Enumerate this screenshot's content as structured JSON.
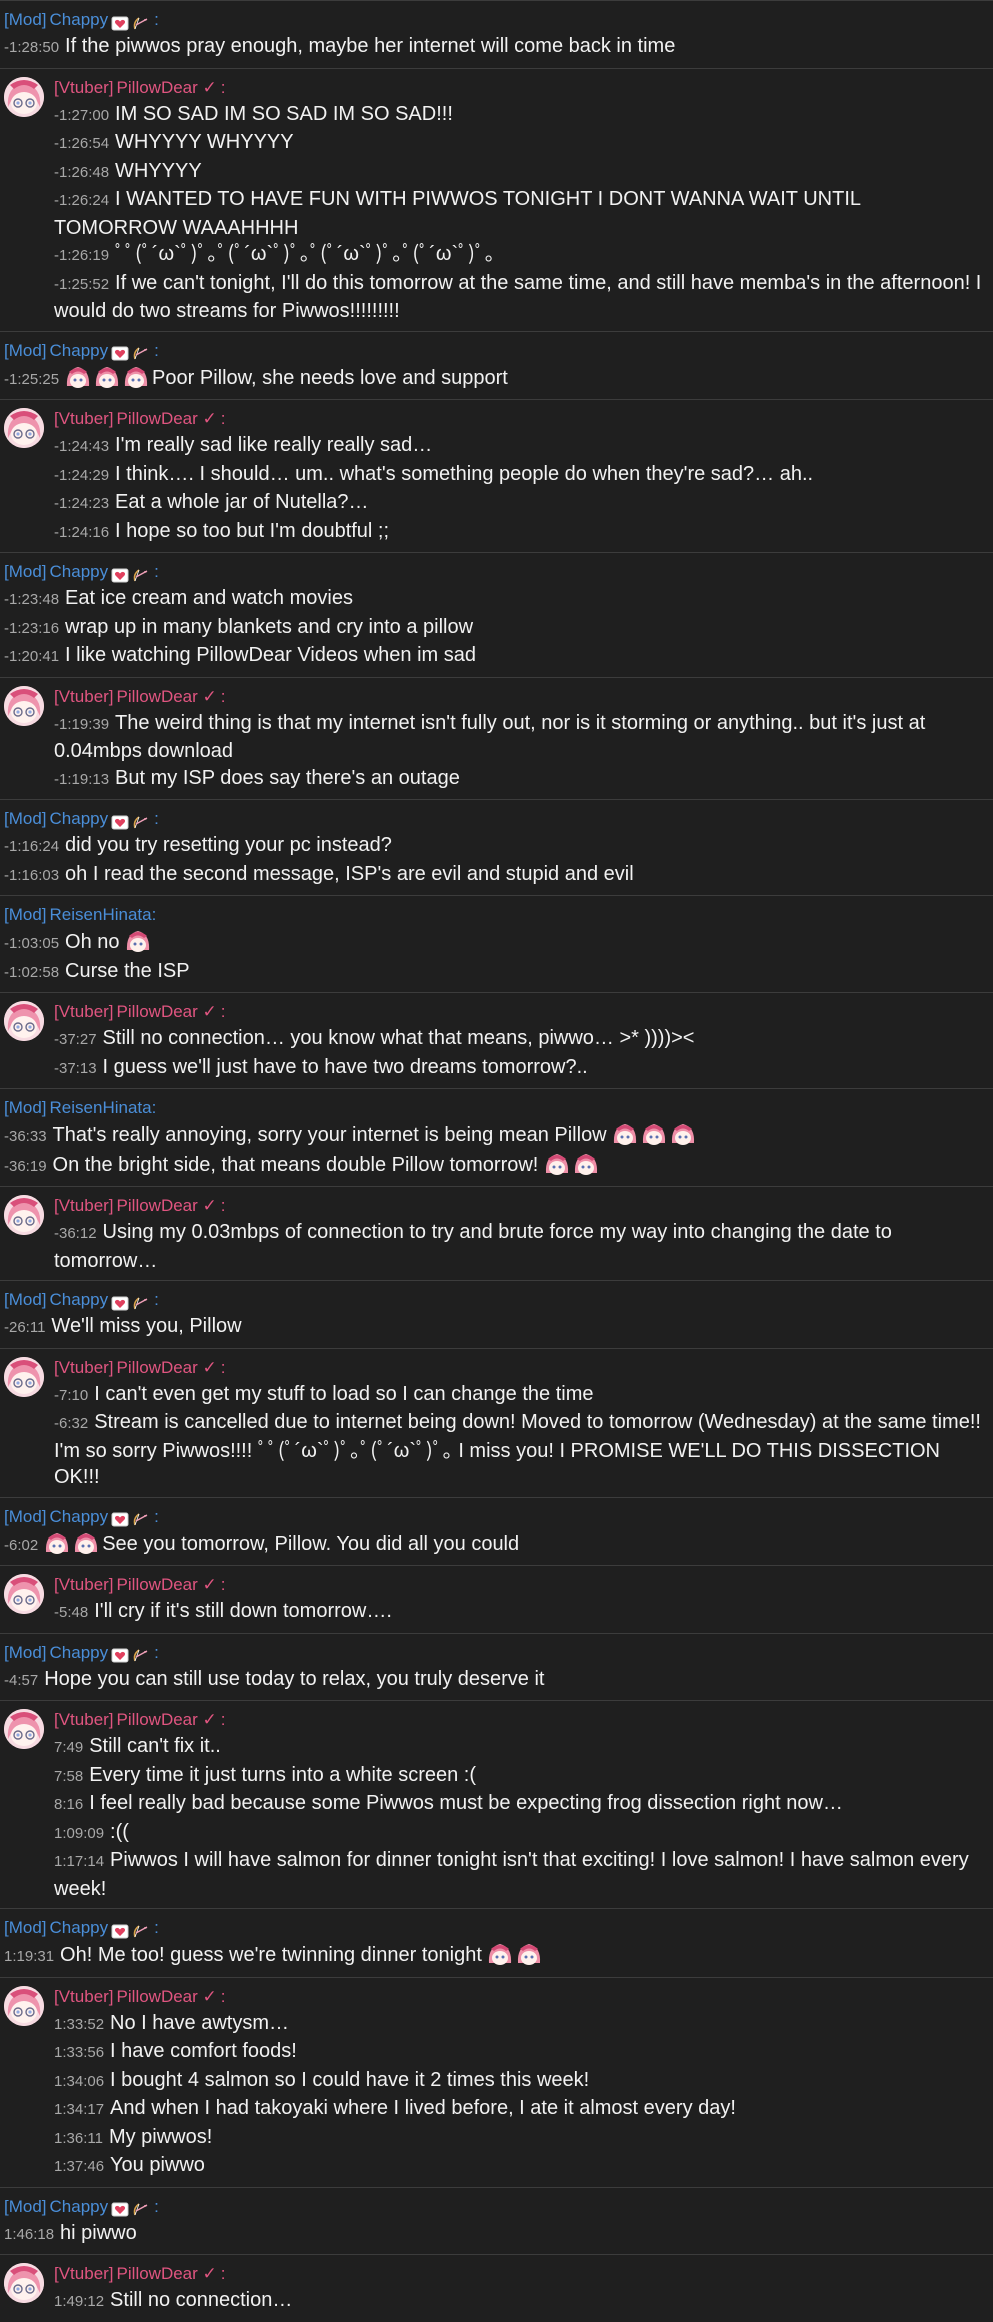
{
  "colors": {
    "background": "#1f1f1f",
    "mod": "#4a8ed8",
    "vtuber": "#e05580",
    "timestamp": "#a8a8a8"
  },
  "groups": [
    {
      "role": "[Mod]",
      "name": "Chappy",
      "type": "mod",
      "badges": true,
      "messages": [
        {
          "time": "-1:28:50",
          "emotes": 0,
          "text": "If the piwwos pray enough, maybe her internet will come back in time"
        }
      ]
    },
    {
      "role": "[Vtuber]",
      "name": "PillowDear ✓",
      "type": "vtuber",
      "badges": false,
      "messages": [
        {
          "time": "-1:27:00",
          "emotes": 0,
          "text": "IM SO SAD IM SO SAD IM SO SAD!!!"
        },
        {
          "time": "-1:26:54",
          "emotes": 0,
          "text": "WHYYYY WHYYYY"
        },
        {
          "time": "-1:26:48",
          "emotes": 0,
          "text": "WHYYYY"
        },
        {
          "time": "-1:26:24",
          "emotes": 0,
          "text": "I WANTED TO HAVE FUN WITH PIWWOS TONIGHT I DONT WANNA WAIT UNTIL TOMORROW WAAAHHHH"
        },
        {
          "time": "-1:26:19",
          "emotes": 0,
          "text": "ﾟﾟ(ﾟ´ω`ﾟ)ﾟ｡ﾟ(ﾟ´ω`ﾟ)ﾟ｡ﾟ(ﾟ´ω`ﾟ)ﾟ｡ﾟ(ﾟ´ω`ﾟ)ﾟ｡"
        },
        {
          "time": "-1:25:52",
          "emotes": 0,
          "text": "If we can't tonight, I'll do this tomorrow at the same time, and still have memba's in the afternoon! I would do two streams for Piwwos!!!!!!!!!"
        }
      ]
    },
    {
      "role": "[Mod]",
      "name": "Chappy",
      "type": "mod",
      "badges": true,
      "messages": [
        {
          "time": "-1:25:25",
          "emotes": 3,
          "text": "Poor Pillow, she needs love and support"
        }
      ]
    },
    {
      "role": "[Vtuber]",
      "name": "PillowDear ✓",
      "type": "vtuber",
      "badges": false,
      "messages": [
        {
          "time": "-1:24:43",
          "emotes": 0,
          "text": "I'm really sad like really really sad…"
        },
        {
          "time": "-1:24:29",
          "emotes": 0,
          "text": "I think…. I should… um.. what's something people do when they're sad?… ah.."
        },
        {
          "time": "-1:24:23",
          "emotes": 0,
          "text": "Eat a whole jar of Nutella?…"
        },
        {
          "time": "-1:24:16",
          "emotes": 0,
          "text": "I hope so too but I'm doubtful ;;"
        }
      ]
    },
    {
      "role": "[Mod]",
      "name": "Chappy",
      "type": "mod",
      "badges": true,
      "messages": [
        {
          "time": "-1:23:48",
          "emotes": 0,
          "text": "Eat ice cream and watch movies"
        },
        {
          "time": "-1:23:16",
          "emotes": 0,
          "text": "wrap up in many blankets and cry into a pillow"
        },
        {
          "time": "-1:20:41",
          "emotes": 0,
          "text": "I like watching PillowDear Videos when im sad"
        }
      ]
    },
    {
      "role": "[Vtuber]",
      "name": "PillowDear ✓",
      "type": "vtuber",
      "badges": false,
      "messages": [
        {
          "time": "-1:19:39",
          "emotes": 0,
          "text": "The weird thing is that my internet isn't fully out, nor is it storming or anything.. but it's just at 0.04mbps download"
        },
        {
          "time": "-1:19:13",
          "emotes": 0,
          "text": "But my ISP does say there's an outage"
        }
      ]
    },
    {
      "role": "[Mod]",
      "name": "Chappy",
      "type": "mod",
      "badges": true,
      "messages": [
        {
          "time": "-1:16:24",
          "emotes": 0,
          "text": "did you try resetting your pc instead?"
        },
        {
          "time": "-1:16:03",
          "emotes": 0,
          "text": "oh I read the second message, ISP's are evil and stupid and evil"
        }
      ]
    },
    {
      "role": "[Mod]",
      "name": "ReisenHinata:",
      "type": "mod",
      "badges": false,
      "messages": [
        {
          "time": "-1:03:05",
          "emotes": 0,
          "text": "Oh no",
          "trailing_emotes": 1
        },
        {
          "time": "-1:02:58",
          "emotes": 0,
          "text": "Curse the ISP"
        }
      ]
    },
    {
      "role": "[Vtuber]",
      "name": "PillowDear ✓",
      "type": "vtuber",
      "badges": false,
      "messages": [
        {
          "time": "-37:27",
          "emotes": 0,
          "text": "Still no connection… you know what that means, piwwo… >* ))))><"
        },
        {
          "time": "-37:13",
          "emotes": 0,
          "text": "I guess we'll just have to have two dreams tomorrow?.."
        }
      ]
    },
    {
      "role": "[Mod]",
      "name": "ReisenHinata:",
      "type": "mod",
      "badges": false,
      "messages": [
        {
          "time": "-36:33",
          "emotes": 0,
          "text": "That's really annoying, sorry your internet is being mean Pillow",
          "trailing_emotes": 3
        },
        {
          "time": "-36:19",
          "emotes": 0,
          "text": "On the bright side, that means double Pillow tomorrow!",
          "trailing_emotes": 2
        }
      ]
    },
    {
      "role": "[Vtuber]",
      "name": "PillowDear ✓",
      "type": "vtuber",
      "badges": false,
      "messages": [
        {
          "time": "-36:12",
          "emotes": 0,
          "text": "Using my 0.03mbps of connection to try and brute force my way into changing the date to tomorrow…"
        }
      ]
    },
    {
      "role": "[Mod]",
      "name": "Chappy",
      "type": "mod",
      "badges": true,
      "messages": [
        {
          "time": "-26:11",
          "emotes": 0,
          "text": "We'll miss you, Pillow"
        }
      ]
    },
    {
      "role": "[Vtuber]",
      "name": "PillowDear ✓",
      "type": "vtuber",
      "badges": false,
      "messages": [
        {
          "time": "-7:10",
          "emotes": 0,
          "text": "I can't even get my stuff to load so I can change the time"
        },
        {
          "time": "-6:32",
          "emotes": 0,
          "text": "Stream is cancelled due to internet being down! Moved to tomorrow (Wednesday) at the same time!! I'm so sorry Piwwos!!!! ﾟﾟ(ﾟ´ω`ﾟ)ﾟ｡ﾟ(ﾟ´ω`ﾟ)ﾟ｡ I miss you! I PROMISE WE'LL DO THIS DISSECTION OK!!!"
        }
      ]
    },
    {
      "role": "[Mod]",
      "name": "Chappy",
      "type": "mod",
      "badges": true,
      "messages": [
        {
          "time": "-6:02",
          "emotes": 2,
          "text": "See you tomorrow, Pillow. You did all you could"
        }
      ]
    },
    {
      "role": "[Vtuber]",
      "name": "PillowDear ✓",
      "type": "vtuber",
      "badges": false,
      "messages": [
        {
          "time": "-5:48",
          "emotes": 0,
          "text": "I'll cry if it's still down tomorrow…."
        }
      ]
    },
    {
      "role": "[Mod]",
      "name": "Chappy",
      "type": "mod",
      "badges": true,
      "messages": [
        {
          "time": "-4:57",
          "emotes": 0,
          "text": "Hope you can still use today to relax, you truly deserve it"
        }
      ]
    },
    {
      "role": "[Vtuber]",
      "name": "PillowDear ✓",
      "type": "vtuber",
      "badges": false,
      "messages": [
        {
          "time": "7:49",
          "emotes": 0,
          "text": "Still can't fix it.."
        },
        {
          "time": "7:58",
          "emotes": 0,
          "text": "Every time it just turns into a white screen :("
        },
        {
          "time": "8:16",
          "emotes": 0,
          "text": "I feel really bad because some Piwwos must be expecting frog dissection right now…"
        },
        {
          "time": "1:09:09",
          "emotes": 0,
          "text": ":(("
        },
        {
          "time": "1:17:14",
          "emotes": 0,
          "text": "Piwwos I will have salmon for dinner tonight isn't that exciting! I love salmon! I have salmon every week!"
        }
      ]
    },
    {
      "role": "[Mod]",
      "name": "Chappy",
      "type": "mod",
      "badges": true,
      "messages": [
        {
          "time": "1:19:31",
          "emotes": 0,
          "text": "Oh! Me too! guess we're twinning dinner tonight",
          "trailing_emotes": 2
        }
      ]
    },
    {
      "role": "[Vtuber]",
      "name": "PillowDear ✓",
      "type": "vtuber",
      "badges": false,
      "messages": [
        {
          "time": "1:33:52",
          "emotes": 0,
          "text": "No I have awtysm…"
        },
        {
          "time": "1:33:56",
          "emotes": 0,
          "text": "I have comfort foods!"
        },
        {
          "time": "1:34:06",
          "emotes": 0,
          "text": "I bought 4 salmon so I could have it 2 times this week!"
        },
        {
          "time": "1:34:17",
          "emotes": 0,
          "text": "And when I had takoyaki where I lived before, I ate it almost every day!"
        },
        {
          "time": "1:36:11",
          "emotes": 0,
          "text": "My piwwos!"
        },
        {
          "time": "1:37:46",
          "emotes": 0,
          "text": "You piwwo"
        }
      ]
    },
    {
      "role": "[Mod]",
      "name": "Chappy",
      "type": "mod",
      "badges": true,
      "messages": [
        {
          "time": "1:46:18",
          "emotes": 0,
          "text": "hi piwwo"
        }
      ]
    },
    {
      "role": "[Vtuber]",
      "name": "PillowDear ✓",
      "type": "vtuber",
      "badges": false,
      "messages": [
        {
          "time": "1:49:12",
          "emotes": 0,
          "text": "Still no connection…"
        }
      ]
    }
  ]
}
